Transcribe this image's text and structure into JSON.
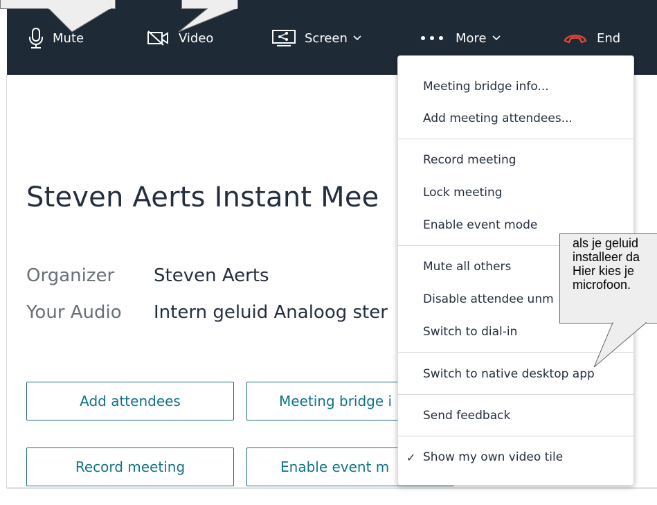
{
  "toolbar": {
    "mute_label": "Mute",
    "video_label": "Video",
    "screen_label": "Screen",
    "more_label": "More",
    "end_label": "End"
  },
  "meeting": {
    "title": "Steven Aerts Instant Mee",
    "organizer_label": "Organizer",
    "organizer_value": "Steven Aerts",
    "audio_label": "Your Audio",
    "audio_value": "Intern geluid Analoog ster"
  },
  "buttons": {
    "add_attendees": "Add attendees",
    "meeting_bridge": "Meeting bridge i",
    "record_meeting": "Record meeting",
    "enable_event": "Enable event m"
  },
  "menu": {
    "items": [
      "Meeting bridge info...",
      "Add meeting attendees...",
      "Record meeting",
      "Lock meeting",
      "Enable event mode",
      "Mute all others",
      "Disable attendee unm",
      "Switch to dial-in",
      "Switch to native desktop app",
      "Send feedback",
      "Show my own video tile"
    ],
    "check_mark": "✓"
  },
  "tooltip": {
    "lines": [
      "als je geluid",
      "installeer da",
      "Hier kies je",
      "microfoon."
    ]
  },
  "colors": {
    "toolbar_bg": "#1f2a37",
    "end_icon": "#e0463b",
    "button_border": "#1b6b7a",
    "button_text": "#0f7386"
  }
}
